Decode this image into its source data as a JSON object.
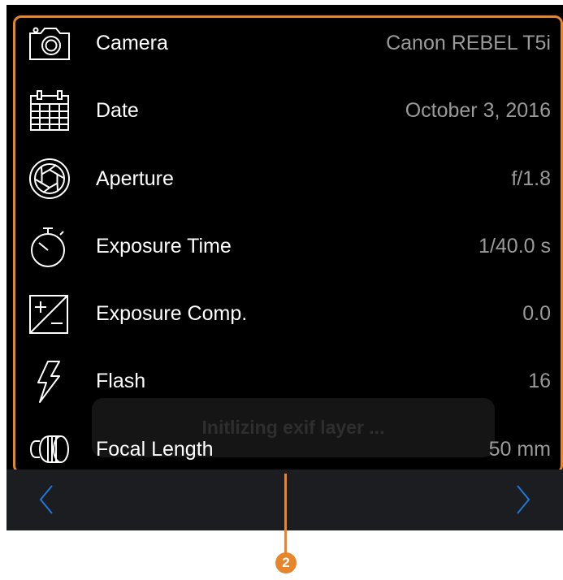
{
  "exif": {
    "rows": [
      {
        "icon": "camera-icon",
        "label": "Camera",
        "value": "Canon  REBEL T5i"
      },
      {
        "icon": "calendar-icon",
        "label": "Date",
        "value": "October 3, 2016"
      },
      {
        "icon": "aperture-icon",
        "label": "Aperture",
        "value": "f/1.8"
      },
      {
        "icon": "stopwatch-icon",
        "label": "Exposure Time",
        "value": "1/40.0 s"
      },
      {
        "icon": "exposure-comp-icon",
        "label": "Exposure Comp.",
        "value": "0.0"
      },
      {
        "icon": "flash-icon",
        "label": "Flash",
        "value": "16"
      },
      {
        "icon": "lens-icon",
        "label": "Focal Length",
        "value": "50 mm"
      }
    ]
  },
  "toast": {
    "text": "Initlizing exif layer ..."
  },
  "navigation": {
    "prev_icon": "chevron-left-icon",
    "next_icon": "chevron-right-icon"
  },
  "callout": {
    "number": "2"
  },
  "colors": {
    "accent": "#e8842a",
    "nav_blue": "#1e78d6",
    "background": "#000000",
    "toolbar": "#1c1d21"
  }
}
